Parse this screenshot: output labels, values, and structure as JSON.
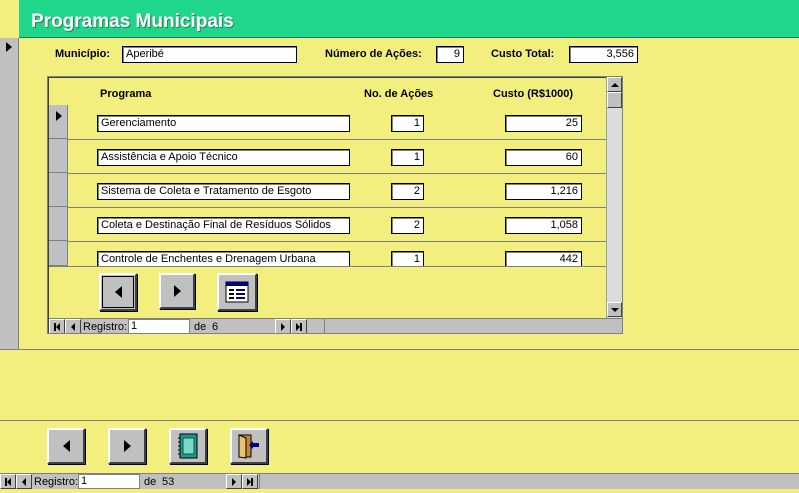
{
  "form": {
    "title": "Programas Municipais",
    "municipio_label": "Município:",
    "municipio_value": "Aperibé",
    "num_acoes_label": "Número de Ações:",
    "num_acoes_value": "9",
    "custo_total_label": "Custo Total:",
    "custo_total_value": "3,556"
  },
  "subform": {
    "columns": [
      "Programa",
      "No. de Ações",
      "Custo (R$1000)"
    ],
    "rows": [
      {
        "programa": "Gerenciamento",
        "acoes": "1",
        "custo": "25"
      },
      {
        "programa": "Assistência e Apoio Técnico",
        "acoes": "1",
        "custo": "60"
      },
      {
        "programa": "Sistema de Coleta e Tratamento de Esgoto",
        "acoes": "2",
        "custo": "1,216"
      },
      {
        "programa": "Coleta e Destinação Final de Resíduos Sólidos",
        "acoes": "2",
        "custo": "1,058"
      },
      {
        "programa": "Controle de Enchentes e Drenagem Urbana",
        "acoes": "1",
        "custo": "442"
      }
    ],
    "nav": {
      "label": "Registro:",
      "current": "1",
      "of_label": "de",
      "total": "6"
    }
  },
  "main_nav": {
    "label": "Registro:",
    "current": "1",
    "of_label": "de",
    "total": "53"
  },
  "icons": {
    "prev": "triangle-left-icon",
    "next": "triangle-right-icon",
    "detail": "form-list-icon",
    "notebook": "notebook-icon",
    "exit": "exit-door-icon"
  },
  "colors": {
    "background": "#f2ef7e",
    "header": "#1fd68a",
    "button_face": "#c0c0c0"
  }
}
